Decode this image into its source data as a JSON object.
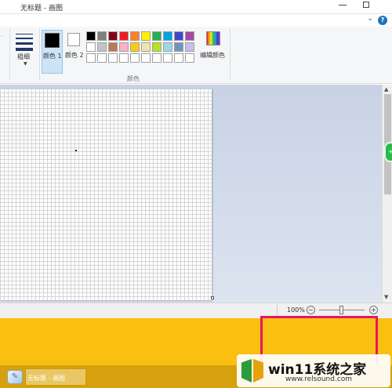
{
  "window": {
    "title": "无标题 - 画图"
  },
  "ribbon": {
    "size_label": "粗细",
    "color1_label": "颜色 1",
    "color2_label": "颜色 2",
    "group_label": "颜色",
    "edit_colors_label": "编辑颜色",
    "help_icon": "?",
    "palette_row1": [
      "#000000",
      "#7f7f7f",
      "#880015",
      "#ed1c24",
      "#ff7f27",
      "#fff200",
      "#22b14c",
      "#00a2e8",
      "#3f48cc",
      "#a349a4"
    ],
    "palette_row2": [
      "#ffffff",
      "#c3c3c3",
      "#b97a57",
      "#ffaec9",
      "#ffc90e",
      "#efe4b0",
      "#b5e61d",
      "#99d9ea",
      "#7092be",
      "#c8bfe7"
    ],
    "palette_row3": [
      "#ffffff",
      "#ffffff",
      "#ffffff",
      "#ffffff",
      "#ffffff",
      "#ffffff",
      "#ffffff",
      "#ffffff",
      "#ffffff",
      "#ffffff"
    ]
  },
  "statusbar": {
    "zoom": "100%",
    "zoom_out": "−",
    "zoom_in": "+"
  },
  "taskbar": {
    "item_label": "无标题 - 画图"
  },
  "watermark": {
    "title": "win11系统之家",
    "url": "www.relsound.com"
  },
  "colors": {
    "desktop": "#f9c012",
    "highlight": "#e8175d",
    "selected_color": "#000000"
  }
}
